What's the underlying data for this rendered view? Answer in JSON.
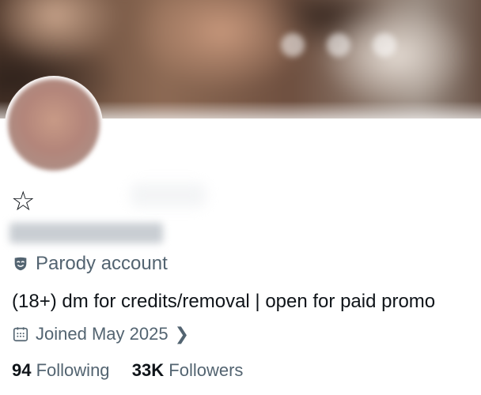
{
  "profile": {
    "name_glyph": "☆",
    "badge_label": "Parody account",
    "bio": "(18+) dm for credits/removal | open for paid promo",
    "joined": "Joined May 2025",
    "stats": {
      "following_count": "94",
      "following_label": "Following",
      "followers_count": "33K",
      "followers_label": "Followers"
    }
  },
  "icons": {
    "badge": "parody-mask-icon",
    "joined": "calendar-icon",
    "chevron": "chevron-right-icon"
  },
  "colors": {
    "primary_text": "#0f1419",
    "secondary_text": "#536471",
    "background": "#ffffff"
  }
}
